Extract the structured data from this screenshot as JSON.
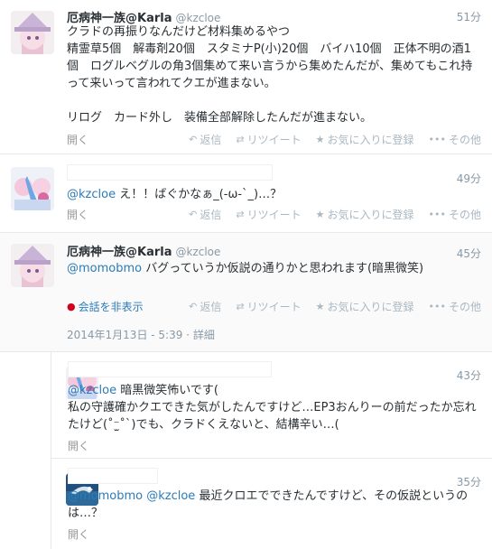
{
  "actions": {
    "reply": "返信",
    "retweet": "リツイート",
    "favorite": "お気に入りに登録",
    "more": "その他",
    "open": "開く",
    "hide_conversation": "会話を非表示"
  },
  "tweets": [
    {
      "name": "厄病神一族@Karla",
      "handle": "@kzcloe",
      "time": "51分",
      "body": "クラドの再振りなんだけど材料集めるやつ\n精霊草5個　解毒剤20個　スタミナP(小)20個　バイハ10個　正体不明の酒1個　ログルベグルの角3個集めて来い言うから集めたんだが、集めてもこれ持って来いって言われてクエが進まない。\n\nリログ　カード外し　装備全部解除したんだが進まない。"
    },
    {
      "name": "",
      "handle": "",
      "time": "49分",
      "mention": "@kzcloe",
      "body": " え！！ばぐかなぁ_(-ω-`_)…？"
    },
    {
      "name": "厄病神一族@Karla",
      "handle": "@kzcloe",
      "time": "45分",
      "mention": "@momobmo",
      "body": " バグっていうか仮説の通りかと思われます(暗黒微笑)",
      "datetime": "2014年1月13日 - 5:39",
      "details": "詳細"
    },
    {
      "name": "",
      "handle": "",
      "time": "43分",
      "mention": "@kzcloe",
      "body": " 暗黒微笑怖いです(\n私の守護確かクエできた気がしたんですけど…EP3おんりーの前だったか忘れたけど(˚⁻̫˚`)でも、クラドくえないと、結構辛い…("
    },
    {
      "name": "",
      "handle": "",
      "time": "35分",
      "mention": "@momobmo @kzcloe",
      "body": " 最近クロエでできたんですけど、その仮説というのは…？"
    }
  ],
  "colors": {
    "link": "#2b7bb9",
    "muted": "#8899a6",
    "text": "#292f33",
    "hide_icon": "#d0021b"
  }
}
